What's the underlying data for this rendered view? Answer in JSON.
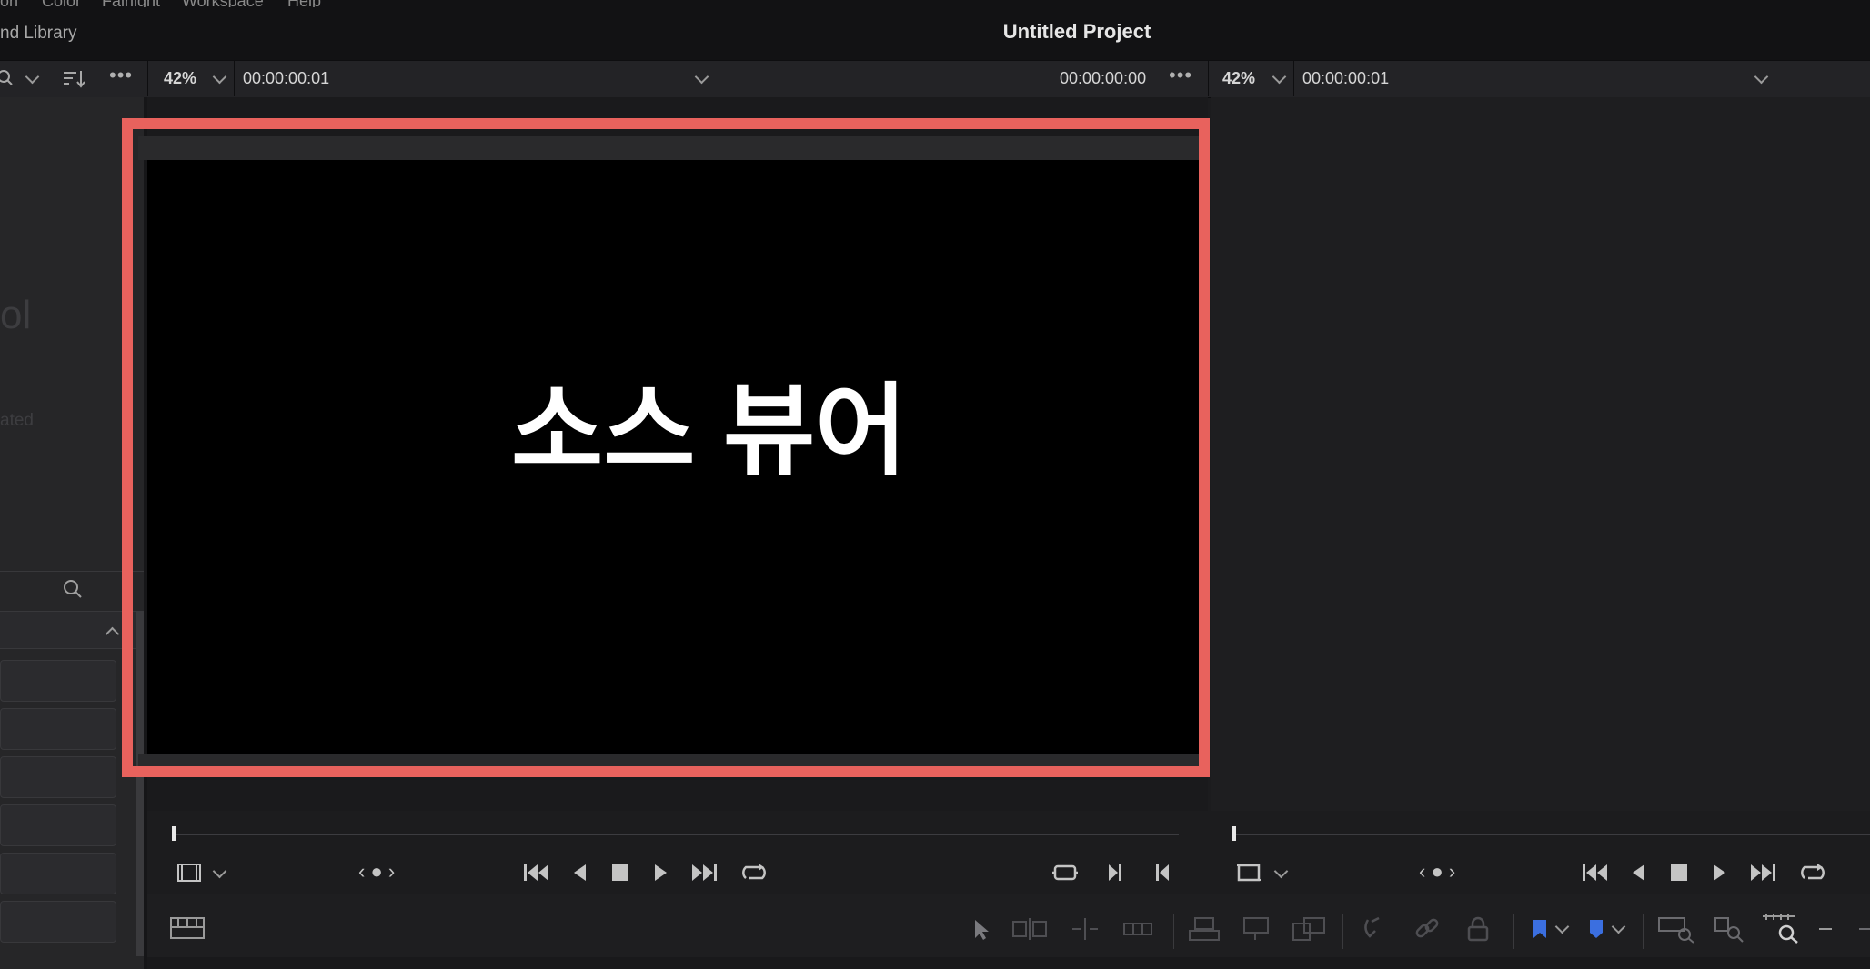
{
  "menu": {
    "items": [
      "on",
      "Color",
      "Fairlight",
      "Workspace",
      "Help"
    ]
  },
  "header": {
    "project_title": "Untitled Project",
    "library_label": "nd Library"
  },
  "source_toolbar": {
    "zoom": "42%",
    "timecode_left": "00:00:00:01",
    "timecode_right": "00:00:00:00"
  },
  "program_toolbar": {
    "zoom": "42%",
    "timecode": "00:00:00:01"
  },
  "left_panel": {
    "ghost_title": "ol",
    "ghost_subtitle": "ated"
  },
  "source_viewer": {
    "overlay_text": "소스 뷰어"
  },
  "colors": {
    "callout": "#e8625d",
    "background": "#1c1c1e",
    "flag_blue": "#3b6fe0"
  }
}
